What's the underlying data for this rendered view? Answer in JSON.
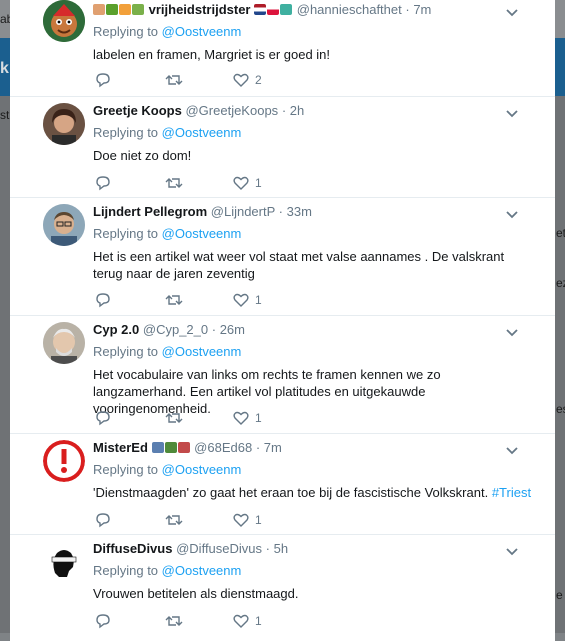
{
  "background": {
    "frag_top": "ab",
    "frag_blue": "k",
    "frag_left": "st",
    "frag_r1": "et",
    "frag_r2": "ez",
    "frag_r3": "es",
    "frag_r4": "e"
  },
  "replying_to": "Replying to",
  "tweets": [
    {
      "name": "vrijheidstrijdster",
      "handle": "@hannieschafthet",
      "time": "· 7m",
      "reply_handle": "@Oostveenm",
      "text": "labelen en framen, Margriet is er goed in!",
      "replies": "",
      "retweets": "",
      "likes": "2",
      "avatar": "mascot"
    },
    {
      "name": "Greetje Koops",
      "handle": "@GreetjeKoops",
      "time": "· 2h",
      "reply_handle": "@Oostveenm",
      "text": "Doe niet zo dom!",
      "replies": "",
      "retweets": "",
      "likes": "1",
      "avatar": "woman"
    },
    {
      "name": "Lijndert Pellegrom",
      "handle": "@LijndertP",
      "time": "· 33m",
      "reply_handle": "@Oostveenm",
      "text": "Het is een artikel wat weer vol staat met valse aannames . De valskrant terug naar de jaren zeventig",
      "replies": "",
      "retweets": "",
      "likes": "1",
      "avatar": "man-glasses"
    },
    {
      "name": "Cyp 2.0",
      "handle": "@Cyp_2_0",
      "time": "· 26m",
      "reply_handle": "@Oostveenm",
      "text": "Het vocabulaire van links om rechts te framen kennen we zo langzamerhand. Een artikel vol platitudes en uitgekauwde vooringenomenheid.",
      "replies": "",
      "retweets": "",
      "likes": "1",
      "avatar": "old-man"
    },
    {
      "name": "MisterEd",
      "handle": "@68Ed68",
      "time": "· 7m",
      "reply_handle": "@Oostveenm",
      "text": "'Dienstmaagden' zo gaat het eraan toe bij de fascistische Volkskrant.",
      "hashtag": "#Triest",
      "replies": "",
      "retweets": "",
      "likes": "1",
      "avatar": "warning"
    },
    {
      "name": "DiffuseDivus",
      "handle": "@DiffuseDivus",
      "time": "· 5h",
      "reply_handle": "@Oostveenm",
      "text": "Vrouwen betitelen als dienstmaagd.",
      "replies": "",
      "retweets": "",
      "likes": "1",
      "avatar": "moor"
    }
  ],
  "colors": {
    "accent": "#1da1f2",
    "muted": "#657786",
    "text": "#14171a"
  }
}
